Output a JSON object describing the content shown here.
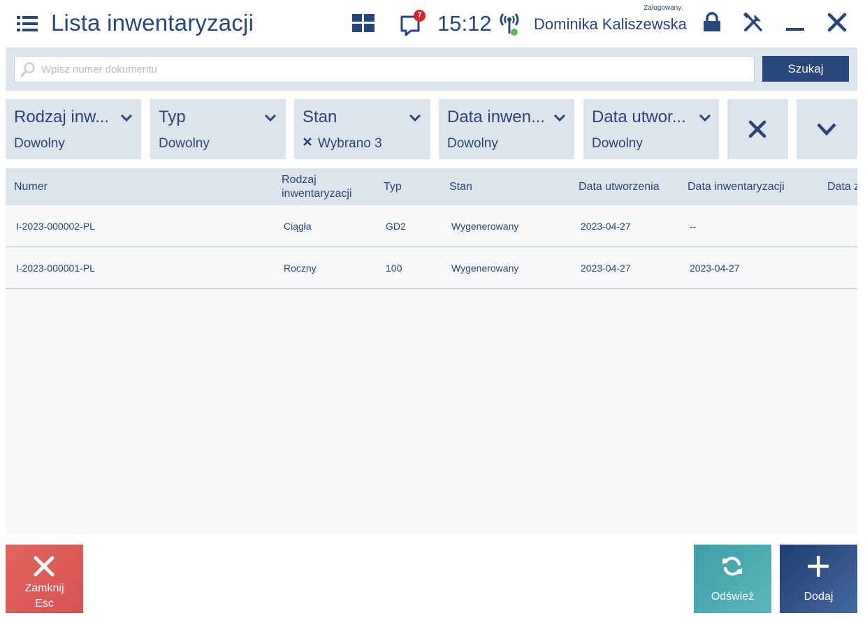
{
  "header": {
    "title": "Lista inwentaryzacji",
    "notifications_count": "7",
    "time": "15:12",
    "logged_label": "Zalogowany:",
    "user_name": "Dominika Kaliszewska"
  },
  "search": {
    "placeholder": "Wpisz numer dokumentu",
    "value": "",
    "button_label": "Szukaj"
  },
  "filters": [
    {
      "title": "Rodzaj inw...",
      "value": "Dowolny"
    },
    {
      "title": "Typ",
      "value": "Dowolny"
    },
    {
      "title": "Stan",
      "value": "Wybrano 3"
    },
    {
      "title": "Data inwen...",
      "value": "Dowolny"
    },
    {
      "title": "Data utwor...",
      "value": "Dowolny"
    }
  ],
  "table": {
    "columns": {
      "numer": "Numer",
      "rodzaj_line1": "Rodzaj",
      "rodzaj_line2": "inwentaryzacji",
      "typ": "Typ",
      "stan": "Stan",
      "data_utworzenia": "Data utworzenia",
      "data_inwentaryzacji": "Data inwentaryzacji",
      "data_extra": "Data z"
    },
    "rows": [
      {
        "numer": "I-2023-000002-PL",
        "rodzaj": "Ciągła",
        "typ": "GD2",
        "stan": "Wygenerowany",
        "data_utworzenia": "2023-04-27",
        "data_inwentaryzacji": "--"
      },
      {
        "numer": "I-2023-000001-PL",
        "rodzaj": "Roczny",
        "typ": "100",
        "stan": "Wygenerowany",
        "data_utworzenia": "2023-04-27",
        "data_inwentaryzacji": "2023-04-27"
      }
    ]
  },
  "footer": {
    "close_label": "Zamknij",
    "close_shortcut": "Esc",
    "refresh_label": "Odśwież",
    "add_label": "Dodaj"
  },
  "colors": {
    "primary": "#27477a",
    "panel": "#dde4ec",
    "close_button": "#d85350",
    "refresh_button": "#4aaab0",
    "add_button": "#2f5088",
    "badge": "#e0212a",
    "signal_dot": "#5cb85c"
  },
  "icons": [
    "menu-icon",
    "tiles-icon",
    "notification-icon",
    "signal-icon",
    "lock-icon",
    "tools-icon",
    "minimize-icon",
    "close-icon",
    "search-icon",
    "chevron-down-icon",
    "clear-filters-icon",
    "expand-icon",
    "refresh-icon",
    "plus-icon"
  ]
}
